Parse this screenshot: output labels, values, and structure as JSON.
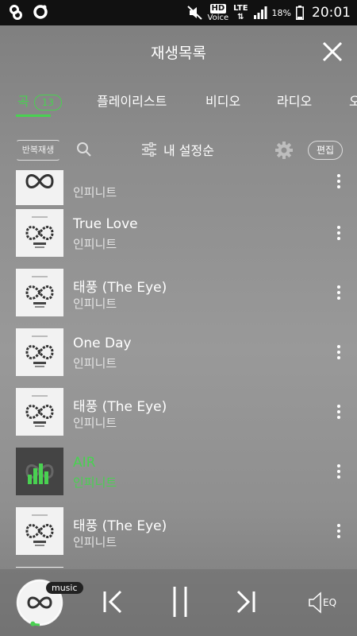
{
  "status_bar": {
    "hd_label": "HD",
    "voice_label": "Voice",
    "network_label": "LTE",
    "battery": "18%",
    "time": "20:01"
  },
  "header": {
    "title": "재생목록"
  },
  "tabs": [
    {
      "label": "곡",
      "count": "13",
      "active": true
    },
    {
      "label": "플레이리스트"
    },
    {
      "label": "비디오"
    },
    {
      "label": "라디오"
    },
    {
      "label": "오"
    }
  ],
  "toolbar": {
    "repeat_label": "반복재생",
    "sort_label": "내 설정순",
    "edit_label": "편집"
  },
  "tracks": [
    {
      "title": "",
      "artist": "인피니트"
    },
    {
      "title": "True Love",
      "artist": "인피니트"
    },
    {
      "title": "태풍 (The Eye)",
      "artist": "인피니트"
    },
    {
      "title": "One Day",
      "artist": "인피니트"
    },
    {
      "title": "태풍 (The Eye)",
      "artist": "인피니트"
    },
    {
      "title": "AIR",
      "artist": "인피니트",
      "playing": true
    },
    {
      "title": "태풍 (The Eye)",
      "artist": "인피니트"
    }
  ],
  "player": {
    "badge": "music",
    "eq_label": "EQ",
    "progress": 0.05
  },
  "colors": {
    "accent": "#49d151"
  }
}
